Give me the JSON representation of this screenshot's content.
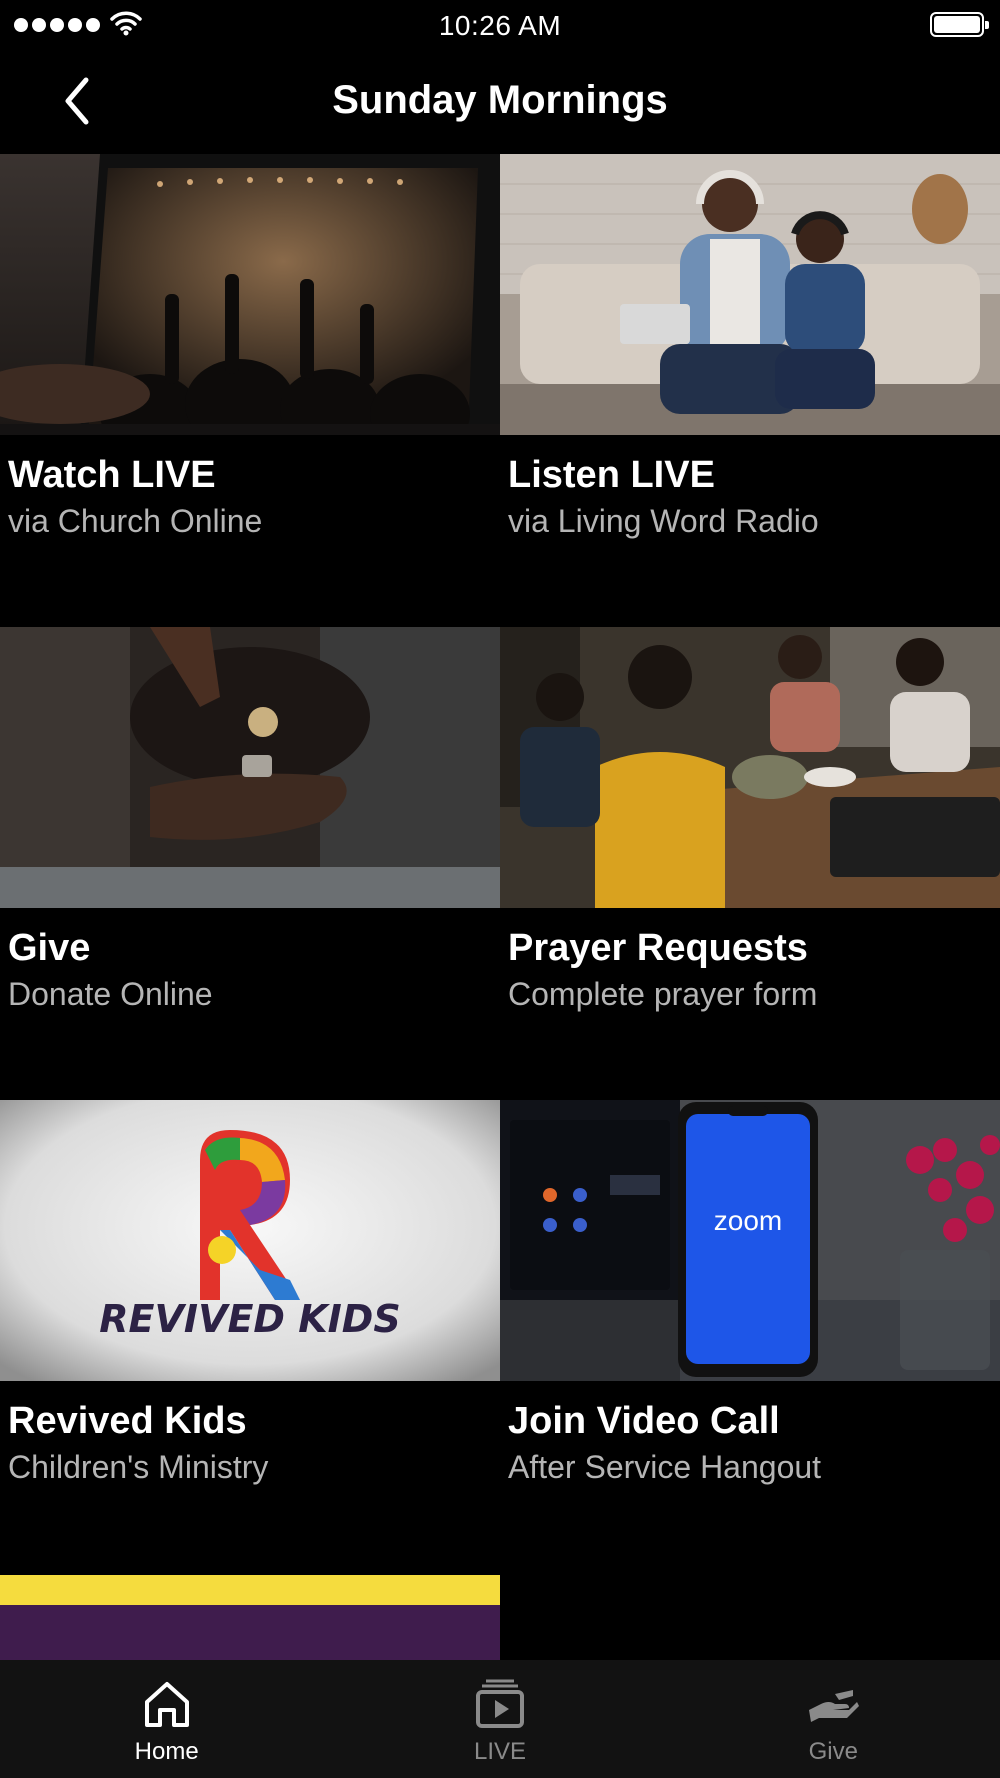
{
  "status_bar": {
    "time": "10:26 AM"
  },
  "nav": {
    "title": "Sunday Mornings"
  },
  "tiles": [
    {
      "title": "Watch LIVE",
      "subtitle": "via Church Online"
    },
    {
      "title": "Listen LIVE",
      "subtitle": "via Living Word Radio"
    },
    {
      "title": "Give",
      "subtitle": "Donate Online"
    },
    {
      "title": "Prayer Requests",
      "subtitle": "Complete prayer form"
    },
    {
      "title": "Revived Kids",
      "subtitle": "Children's Ministry"
    },
    {
      "title": "Join Video Call",
      "subtitle": "After Service Hangout"
    }
  ],
  "tile_images": {
    "revived_kids_logo_text": "REVIVED KIDS",
    "zoom_phone_text": "zoom"
  },
  "tab_bar": {
    "items": [
      {
        "label": "Home",
        "icon": "home-icon",
        "active": true
      },
      {
        "label": "LIVE",
        "icon": "live-video-icon",
        "active": false
      },
      {
        "label": "Give",
        "icon": "give-hand-icon",
        "active": false
      }
    ]
  },
  "colors": {
    "background": "#000000",
    "tab_bar_bg": "#121212",
    "subtitle": "#b5b5b5",
    "inactive_tab": "#8a8a8a",
    "accent_yellow": "#f5dc3e",
    "accent_purple": "#3f1c4d"
  }
}
